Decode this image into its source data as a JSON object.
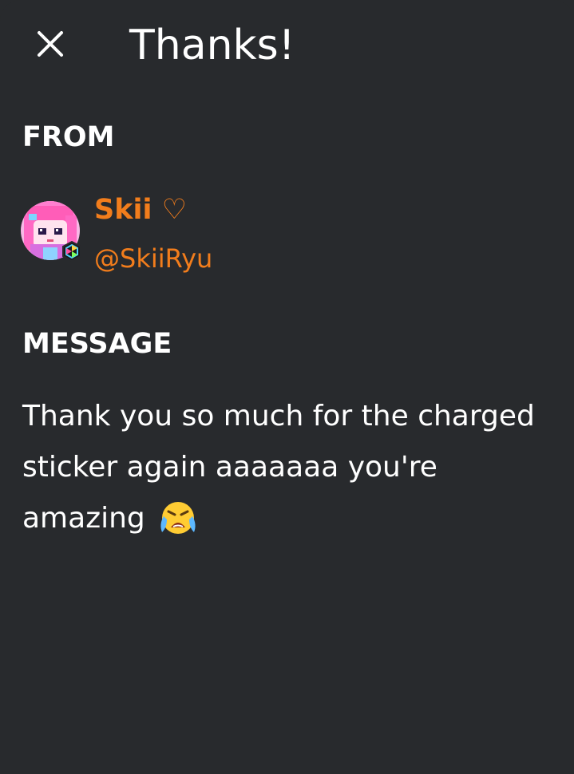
{
  "header": {
    "title": "Thanks!"
  },
  "from": {
    "label": "FROM",
    "name": "Skii ♡",
    "handle": "@SkiiRyu"
  },
  "message": {
    "label": "MESSAGE",
    "text": "Thank you so much for the charged sticker again aaaaaaa you're amazing",
    "emoji": "crying-face-emoji"
  },
  "colors": {
    "background": "#282a2d",
    "accent": "#f27d1c",
    "text": "#ffffff"
  },
  "icons": {
    "close": "close-icon"
  }
}
